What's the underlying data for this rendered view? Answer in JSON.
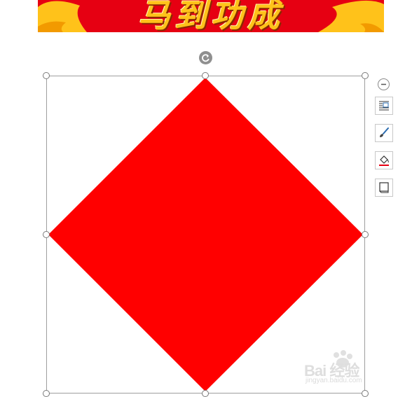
{
  "banner": {
    "text": "马到功成",
    "background_color": "#e60012",
    "ornament_color": "#ffc21a"
  },
  "shape": {
    "type": "diamond",
    "fill_color": "#ff0000",
    "selected": true
  },
  "toolbar": {
    "items": [
      {
        "name": "collapse",
        "icon": "minus-circle-icon"
      },
      {
        "name": "layout-options",
        "icon": "text-wrap-icon"
      },
      {
        "name": "shape-style",
        "icon": "brush-icon"
      },
      {
        "name": "shape-fill",
        "icon": "paint-bucket-icon"
      },
      {
        "name": "shape-outline",
        "icon": "outline-icon"
      }
    ]
  },
  "watermark": {
    "main": "Bai 经验",
    "sub": "jingyan.baidu.com"
  }
}
